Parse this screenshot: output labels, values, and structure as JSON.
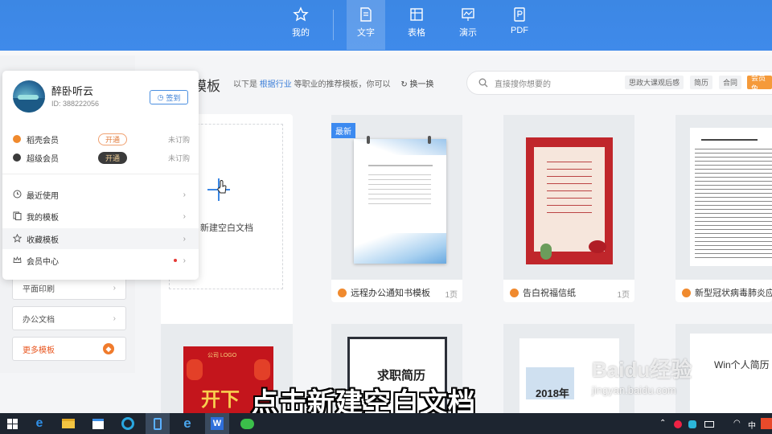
{
  "topnav": {
    "tabs": [
      {
        "label": "我的"
      },
      {
        "label": "文字"
      },
      {
        "label": "表格"
      },
      {
        "label": "演示"
      },
      {
        "label": "PDF"
      }
    ]
  },
  "leftnav": {
    "items": [
      {
        "label": "平面印刷"
      },
      {
        "label": "办公文档"
      },
      {
        "label": "更多模板"
      }
    ]
  },
  "header": {
    "title_fragment": "模板",
    "recommend_prefix": "以下是",
    "industry_link": "根据行业",
    "recommend_suffix": "等职业的推荐模板，你可以",
    "swap_label": "换一换"
  },
  "search": {
    "placeholder": "直接搜你想要的",
    "chips": [
      "思政大课观后感",
      "简历",
      "合同",
      "会员免"
    ]
  },
  "blank_card": {
    "label": "新建空白文档"
  },
  "templates": [
    {
      "name": "远程办公通知书模板",
      "pages": "1页",
      "tag": "最新"
    },
    {
      "name": "告白祝福信纸",
      "pages": "1页"
    },
    {
      "name": "新型冠状病毒肺炎应"
    }
  ],
  "row2": {
    "resume_title": "求职简历",
    "year": "2018年",
    "en_text": "Win个人简历",
    "logo_text": "公司 LOGO",
    "cn_text": "开下"
  },
  "user_popup": {
    "name": "醉卧听云",
    "id": "ID: 388222056",
    "signin": "签到",
    "memberships": [
      {
        "label": "稻壳会员",
        "action": "开通",
        "state": "未订购",
        "color": "#f08a2e"
      },
      {
        "label": "超级会员",
        "action": "开通",
        "state": "未订购",
        "color": "#3b3b3b"
      }
    ],
    "menu": [
      {
        "label": "最近使用"
      },
      {
        "label": "我的模板"
      },
      {
        "label": "收藏模板"
      },
      {
        "label": "会员中心"
      }
    ]
  },
  "overlay": {
    "subtitle": "点击新建空白文档",
    "watermark": "Baidu经验",
    "watermark_url": "jingyan.baidu.com"
  },
  "taskbar": {
    "tray_ime": "中"
  }
}
